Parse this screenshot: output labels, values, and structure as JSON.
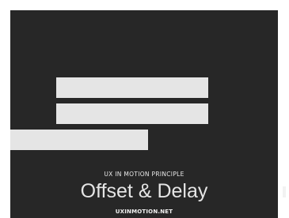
{
  "card": {
    "eyebrow": "UX IN MOTION PRINCIPLE",
    "title": "Offset & Delay",
    "site": "UXINMOTION.NET"
  },
  "colors": {
    "background": "#272727",
    "bars": "#e5e5e5",
    "text": "#e5e5e5"
  }
}
